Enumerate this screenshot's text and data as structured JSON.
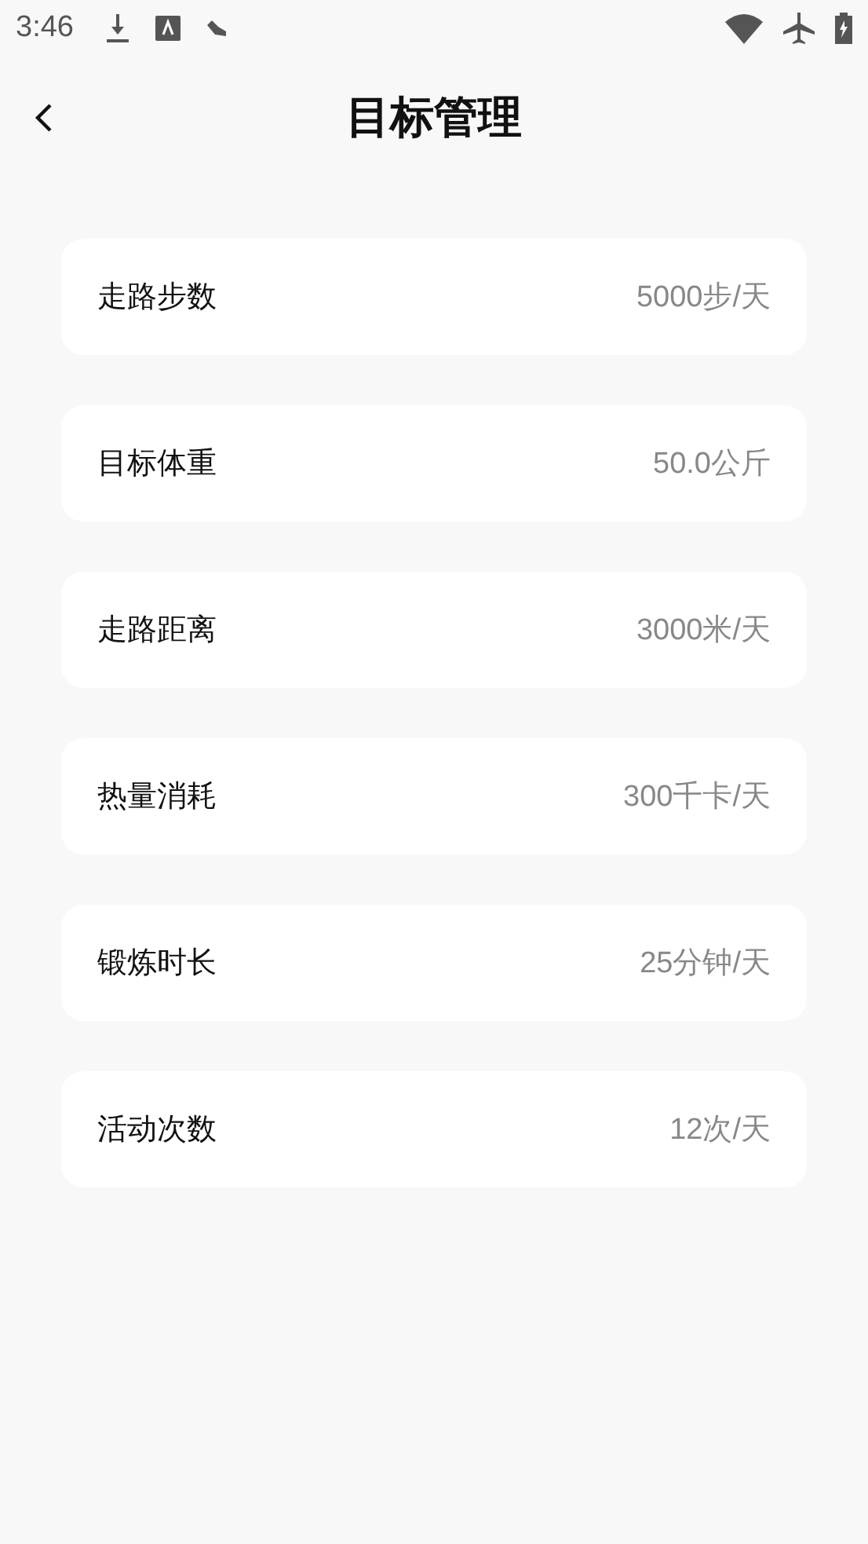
{
  "status_bar": {
    "time": "3:46"
  },
  "header": {
    "title": "目标管理"
  },
  "goals": [
    {
      "label": "走路步数",
      "value": "5000步/天"
    },
    {
      "label": "目标体重",
      "value": "50.0公斤"
    },
    {
      "label": "走路距离",
      "value": "3000米/天"
    },
    {
      "label": "热量消耗",
      "value": "300千卡/天"
    },
    {
      "label": "锻炼时长",
      "value": "25分钟/天"
    },
    {
      "label": "活动次数",
      "value": "12次/天"
    }
  ]
}
